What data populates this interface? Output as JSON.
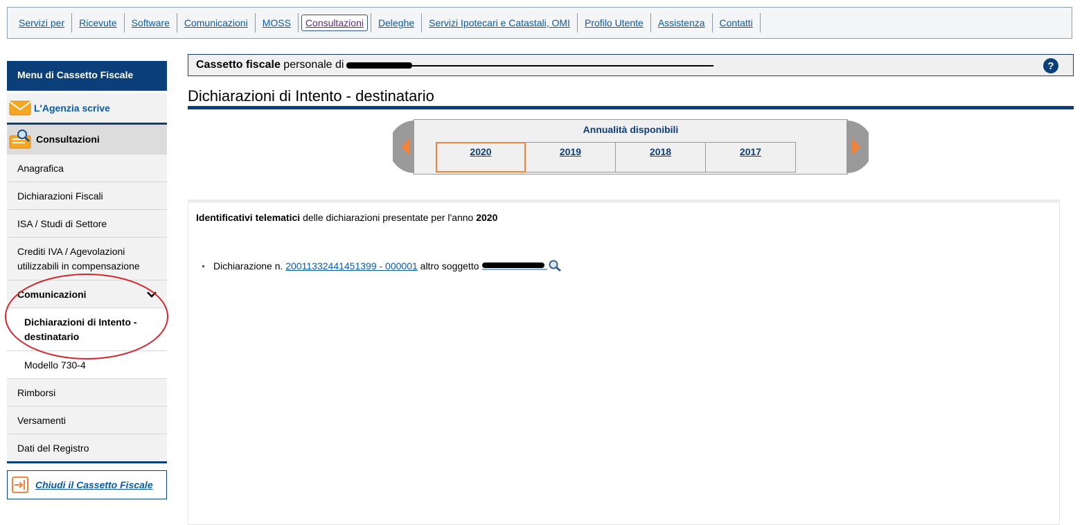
{
  "topnav": {
    "items": [
      {
        "label": "Servizi per"
      },
      {
        "label": "Ricevute"
      },
      {
        "label": "Software"
      },
      {
        "label": "Comunicazioni"
      },
      {
        "label": "MOSS"
      },
      {
        "label": "Consultazioni",
        "active": true
      },
      {
        "label": "Deleghe"
      },
      {
        "label": "Servizi Ipotecari e Catastali, OMI"
      },
      {
        "label": "Profilo Utente"
      },
      {
        "label": "Assistenza"
      },
      {
        "label": "Contatti"
      }
    ]
  },
  "sidebar": {
    "title": "Menu di Cassetto Fiscale",
    "agenzia": "L'Agenzia scrive",
    "consultazioni": "Consultazioni",
    "items": {
      "anagrafica": "Anagrafica",
      "dichiarazioni_fiscali": "Dichiarazioni Fiscali",
      "isa": "ISA / Studi di Settore",
      "crediti_iva": "Crediti IVA / Agevolazioni utilizzabili in compensazione",
      "comunicazioni": "Comunicazioni",
      "dich_intento": "Dichiarazioni di Intento - destinatario",
      "modello_730": "Modello 730-4",
      "rimborsi": "Rimborsi",
      "versamenti": "Versamenti",
      "dati_registro": "Dati del Registro"
    },
    "close": "Chiudi il Cassetto Fiscale"
  },
  "header": {
    "bold": "Cassetto fiscale",
    "text": "personale di"
  },
  "page": {
    "title": "Dichiarazioni di Intento - destinatario"
  },
  "years": {
    "label": "Annualità disponibili",
    "list": [
      "2020",
      "2019",
      "2018",
      "2017"
    ],
    "selected": "2020"
  },
  "content": {
    "intro_bold": "Identificativi telematici",
    "intro_text": "delle dichiarazioni presentate per l'anno",
    "intro_year": "2020",
    "decl_prefix": "Dichiarazione n.",
    "decl_number": "20011332441451399 - 000001",
    "decl_suffix": "altro soggetto"
  },
  "colors": {
    "navy": "#0b3f7a",
    "link": "#0a5aa8",
    "active_tab_border": "#f0843a",
    "annotation": "#d6262e"
  }
}
